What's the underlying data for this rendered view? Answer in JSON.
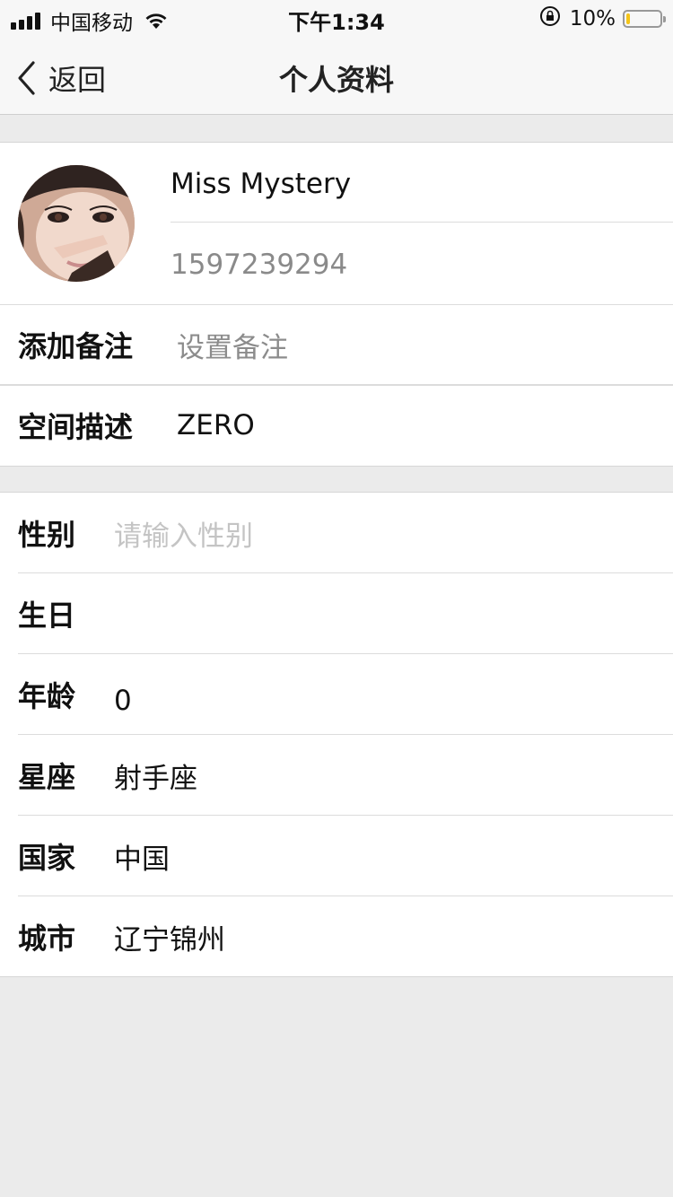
{
  "status_bar": {
    "carrier": "中国移动",
    "time": "下午1:34",
    "battery_percent": "10%",
    "battery_level": 0.1,
    "battery_color": "#f5c518"
  },
  "nav": {
    "back_label": "返回",
    "title": "个人资料"
  },
  "profile": {
    "name": "Miss Mystery",
    "id": "1597239294"
  },
  "section1": {
    "remark_label": "添加备注",
    "remark_placeholder": "设置备注",
    "space_label": "空间描述",
    "space_value": "ZERO"
  },
  "details": {
    "gender_label": "性别",
    "gender_placeholder": "请输入性别",
    "birthday_label": "生日",
    "birthday_value": "",
    "age_label": "年龄",
    "age_value": "0",
    "zodiac_label": "星座",
    "zodiac_value": "射手座",
    "country_label": "国家",
    "country_value": "中国",
    "city_label": "城市",
    "city_value": "辽宁锦州"
  }
}
